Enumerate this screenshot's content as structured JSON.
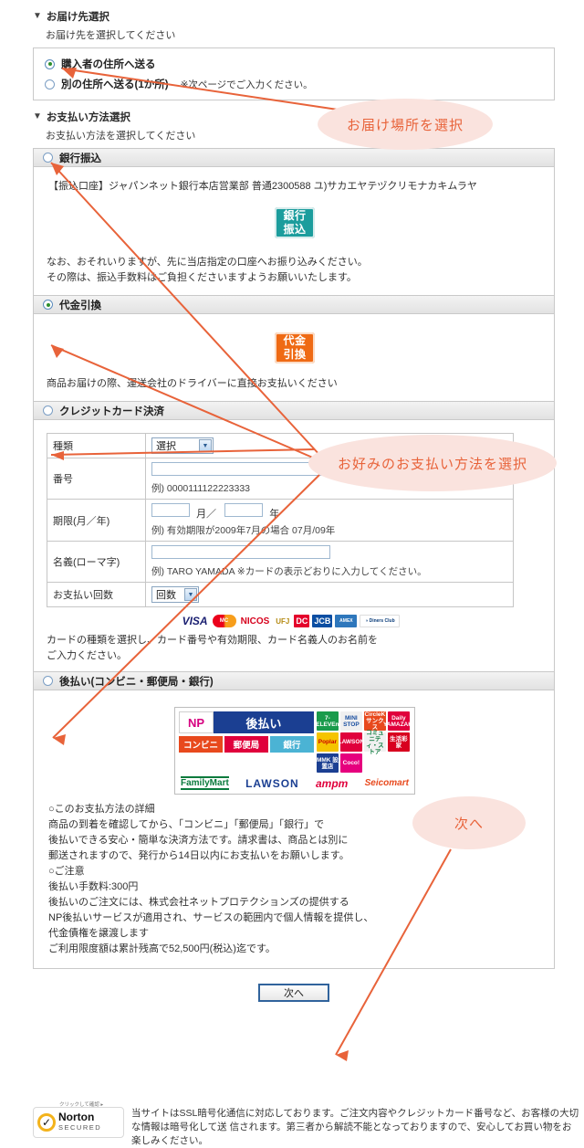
{
  "delivery": {
    "heading": "お届け先選択",
    "sub": "お届け先を選択してください",
    "options": [
      {
        "label": "購入者の住所へ送る",
        "note": "",
        "selected": true
      },
      {
        "label": "別の住所へ送る(1か所)",
        "note": "※次ページでご入力ください。",
        "selected": false
      }
    ]
  },
  "payment": {
    "heading": "お支払い方法選択",
    "sub": "お支払い方法を選択してください",
    "bank": {
      "title": "銀行振込",
      "selected": false,
      "account": "【振込口座】ジャパンネット銀行本店営業部  普通2300588  ユ)サカエヤテヅクリモナカキムラヤ",
      "badge_line1": "銀行",
      "badge_line2": "振込",
      "note1": "なお、おそれいりますが、先に当店指定の口座へお振り込みください。",
      "note2": "その際は、振込手数料はご負担くださいますようお願いいたします。"
    },
    "cod": {
      "title": "代金引換",
      "selected": true,
      "badge_line1": "代金",
      "badge_line2": "引換",
      "note": "商品お届けの際、運送会社のドライバーに直接お支払いください"
    },
    "credit": {
      "title": "クレジットカード決済",
      "selected": false,
      "rows": [
        {
          "label": "種類",
          "control": "select",
          "value": "選択",
          "example": ""
        },
        {
          "label": "番号",
          "control": "text",
          "value": "",
          "example": "例)  0000111122223333"
        },
        {
          "label": "期限(月／年)",
          "control": "expiry",
          "value": "",
          "unit1": "月／",
          "unit2": "年",
          "example": "例)  有効期限が2009年7月の場合  07月/09年"
        },
        {
          "label": "名義(ローマ字)",
          "control": "text",
          "value": "",
          "example": "例)  TARO YAMADA ※カードの表示どおりに入力してください。"
        },
        {
          "label": "お支払い回数",
          "control": "select",
          "value": "回数",
          "example": ""
        }
      ],
      "brands": [
        {
          "name": "VISA",
          "bg": "#ffffff",
          "fg": "#1a1f71"
        },
        {
          "name": "MasterCard",
          "bg": "#ffffff",
          "fg": "#eb6420"
        },
        {
          "name": "NICOS",
          "bg": "#ffffff",
          "fg": "#d6001c"
        },
        {
          "name": "UFJ",
          "bg": "#ffffff",
          "fg": "#b58b15"
        },
        {
          "name": "DC",
          "bg": "#e4002b",
          "fg": "#ffffff"
        },
        {
          "name": "JCB",
          "bg": "#0b4ea2",
          "fg": "#ffffff"
        },
        {
          "name": "AMEX",
          "bg": "#2e77bc",
          "fg": "#ffffff"
        },
        {
          "name": "Diners Club International",
          "bg": "#ffffff",
          "fg": "#0b3d7a"
        }
      ],
      "note1": "カードの種類を選択し、カード番号や有効期限、カード名義人のお名前を",
      "note2": "ご入力ください。"
    },
    "deferred": {
      "title": "後払い(コンビニ・郵便局・銀行)",
      "selected": false,
      "banner": {
        "np_mark": "NP",
        "np_title": "後払い",
        "tags": [
          {
            "label": "コンビニ",
            "bg": "#e8491d"
          },
          {
            "label": "郵便局",
            "bg": "#e0003c"
          },
          {
            "label": "銀行",
            "bg": "#4bb3d4"
          }
        ],
        "stores_row1": [
          {
            "label": "7-ELEVEn",
            "bg": "#1a9b4c"
          },
          {
            "label": "MINI STOP",
            "bg": "#f0f0f0",
            "fg": "#1a4fa0"
          },
          {
            "label": "CircleK サンクス",
            "bg": "#e8491d"
          },
          {
            "label": "Daily YAMAZAKI",
            "bg": "#e0003c"
          },
          {
            "label": "Poplar",
            "bg": "#f5c400",
            "fg": "#c00"
          }
        ],
        "stores_row2": [
          {
            "label": "LAWSON",
            "bg": "#e0003c"
          },
          {
            "label": "コミュニティ・ストア",
            "bg": "#f0f0f0",
            "fg": "#0a7a3c"
          },
          {
            "label": "生活彩家",
            "bg": "#d8001f"
          },
          {
            "label": "MMK 設置店",
            "bg": "#1b3f92"
          },
          {
            "label": "Coco!",
            "bg": "#e6007e"
          }
        ],
        "brands_row": [
          "FamilyMart",
          "LAWSON",
          "ampm",
          "Seicomart"
        ]
      },
      "detail_head": "○このお支払方法の詳細",
      "detail_lines": [
        "商品の到着を確認してから、「コンビニ」「郵便局」「銀行」で",
        "後払いできる安心・簡単な決済方法です。請求書は、商品とは別に",
        "郵送されますので、発行から14日以内にお支払いをお願いします。"
      ],
      "caution_head": "○ご注意",
      "caution_lines": [
        "後払い手数料:300円",
        "後払いのご注文には、株式会社ネットプロテクションズの提供する",
        "NP後払いサービスが適用され、サービスの範囲内で個人情報を提供し、",
        "代金債権を譲渡します",
        "ご利用限度額は累計残高で52,500円(税込)迄です。"
      ]
    }
  },
  "next_button": "次へ",
  "footer": {
    "norton_tip": "クリックして確認 ▸",
    "norton_main": "Norton",
    "norton_sub": "SECURED",
    "ssl_line1": "当サイトはSSL暗号化通信に対応しております。ご注文内容やクレジットカード番号など、お客様の大切な情報は暗号化して送",
    "ssl_line2": "信されます。第三者から解読不能となっておりますので、安心してお買い物をお楽しみください。"
  },
  "annotations": [
    {
      "text": "お届け場所を選択",
      "key": "delivery_place"
    },
    {
      "text": "お好みのお支払い方法を選択",
      "key": "payment_choice"
    },
    {
      "text": "次へ",
      "key": "next"
    }
  ],
  "colors": {
    "accent": "#e8633a",
    "callout_bg": "#fae3de"
  }
}
